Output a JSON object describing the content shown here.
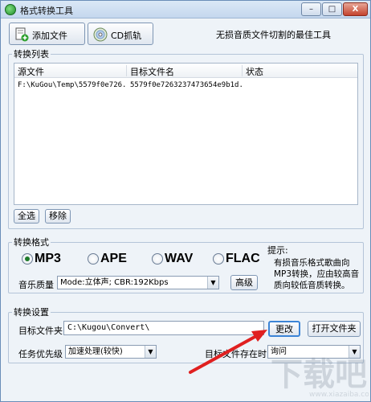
{
  "window": {
    "title": "格式转换工具",
    "controls": {
      "minimize": "–",
      "maximize": "□",
      "close": "X"
    }
  },
  "toolbar": {
    "add_file_label": "添加文件",
    "cd_rip_label": "CD抓轨",
    "slogan": "无损音质文件切割的最佳工具"
  },
  "file_list": {
    "group_title": "转换列表",
    "columns": [
      "源文件",
      "目标文件名",
      "状态"
    ],
    "rows": [
      {
        "source": "F:\\KuGou\\Temp\\5579f0e726...",
        "target": "5579f0e7263237473654e9b1d...",
        "status": ""
      }
    ],
    "select_all_label": "全选",
    "remove_label": "移除"
  },
  "format": {
    "group_title": "转换格式",
    "options": [
      "MP3",
      "APE",
      "WAV",
      "FLAC"
    ],
    "selected": "MP3",
    "quality_label": "音乐质量",
    "quality_value": "Mode:立体声; CBR:192Kbps",
    "advanced_label": "高级",
    "hint_title": "提示:",
    "hint_text": "有损音乐格式歌曲向MP3转换，应由较高音质向较低音质转换。"
  },
  "settings": {
    "group_title": "转换设置",
    "target_folder_label": "目标文件夹",
    "target_folder_value": "C:\\Kugou\\Convert\\",
    "change_label": "更改",
    "open_folder_label": "打开文件夹",
    "priority_label": "任务优先级",
    "priority_value": "加速处理(较快)",
    "exists_label": "目标文件存在时",
    "exists_value": "询问"
  },
  "colors": {
    "annotation_arrow": "#e02020",
    "radio_selected": "#1e7a2a",
    "title_bar": "#c4d7ee"
  }
}
